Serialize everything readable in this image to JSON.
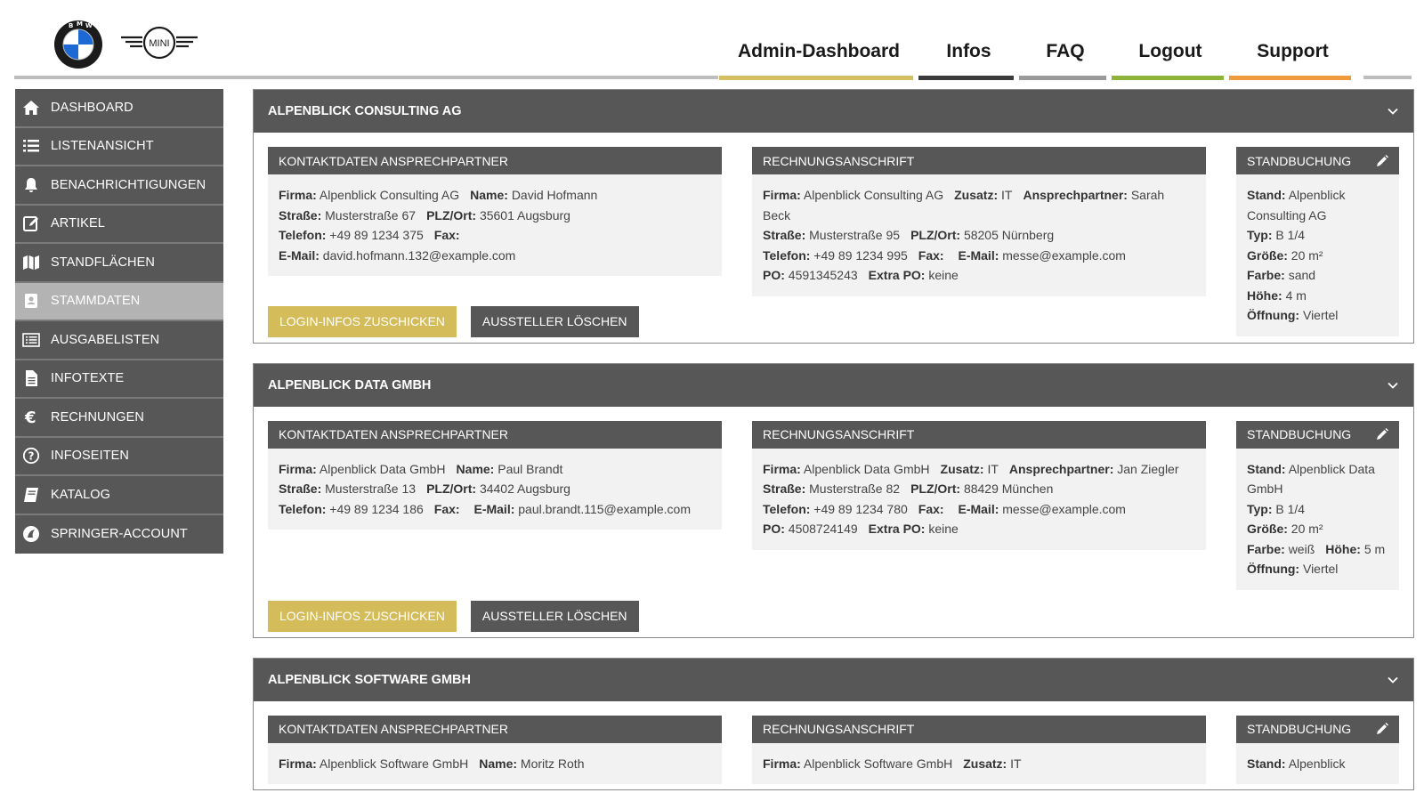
{
  "brand": {
    "logo_bmw_alt": "BMW",
    "logo_mini_alt": "MINI",
    "mini_text": "MINI"
  },
  "topnav": [
    {
      "label": "Admin-Dashboard",
      "color": "#d6bf60"
    },
    {
      "label": "Infos",
      "color": "#3a3a3a"
    },
    {
      "label": "FAQ",
      "color": "#9a9a9a"
    },
    {
      "label": "Logout",
      "color": "#8eb33a"
    },
    {
      "label": "Support",
      "color": "#ef9a3c"
    }
  ],
  "sidebar": [
    {
      "label": "DASHBOARD",
      "icon": "home-icon"
    },
    {
      "label": "LISTENANSICHT",
      "icon": "list-icon"
    },
    {
      "label": "BENACHRICHTIGUNGEN",
      "icon": "bell-icon"
    },
    {
      "label": "ARTIKEL",
      "icon": "edit-icon"
    },
    {
      "label": "STANDFLÄCHEN",
      "icon": "map-icon"
    },
    {
      "label": "STAMMDATEN",
      "icon": "contact-card-icon",
      "active": true
    },
    {
      "label": "AUSGABELISTEN",
      "icon": "table-list-icon"
    },
    {
      "label": "INFOTEXTE",
      "icon": "document-icon"
    },
    {
      "label": "RECHNUNGEN",
      "icon": "euro-icon"
    },
    {
      "label": "INFOSEITEN",
      "icon": "help-circle-icon"
    },
    {
      "label": "KATALOG",
      "icon": "catalog-icon"
    },
    {
      "label": "SPRINGER-ACCOUNT",
      "icon": "springer-icon"
    }
  ],
  "labels": {
    "contact_heading": "KONTAKTDATEN ANSPRECHPARTNER",
    "invoice_heading": "RECHNUNGSANSCHRIFT",
    "booking_heading": "STANDBUCHUNG",
    "firma": "Firma:",
    "name": "Name:",
    "strasse": "Straße:",
    "plzort": "PLZ/Ort:",
    "telefon": "Telefon:",
    "fax": "Fax:",
    "email": "E-Mail:",
    "zusatz": "Zusatz:",
    "ansprechpartner": "Ansprechpartner:",
    "po": "PO:",
    "extra_po": "Extra PO:",
    "stand": "Stand:",
    "typ": "Typ:",
    "groesse": "Größe:",
    "farbe": "Farbe:",
    "hoehe": "Höhe:",
    "oeffnung": "Öffnung:",
    "btn_login": "LOGIN-INFOS ZUSCHICKEN",
    "btn_delete": "AUSSTELLER LÖSCHEN"
  },
  "companies": [
    {
      "title": "ALPENBLICK CONSULTING AG",
      "contact": {
        "firma": "Alpenblick Consulting AG",
        "name": "David Hofmann",
        "strasse": "Musterstraße 67",
        "plzort": "35601 Augsburg",
        "telefon": "+49 89 1234 375",
        "fax": "",
        "email": "david.hofmann.132@example.com"
      },
      "invoice": {
        "firma": "Alpenblick Consulting AG",
        "zusatz": "IT",
        "ansprechpartner": "Sarah Beck",
        "strasse": "Musterstraße 95",
        "plzort": "58205 Nürnberg",
        "telefon": "+49 89 1234 995",
        "fax": "",
        "email": "messe@example.com",
        "po": "4591345243",
        "extra_po": "keine"
      },
      "booking": {
        "stand": "Alpenblick Consulting AG",
        "typ": "B 1/4",
        "groesse": "20 m²",
        "farbe": "sand",
        "hoehe": "4 m",
        "oeffnung": "Viertel"
      }
    },
    {
      "title": "ALPENBLICK DATA GMBH",
      "contact": {
        "firma": "Alpenblick Data GmbH",
        "name": "Paul Brandt",
        "strasse": "Musterstraße 13",
        "plzort": "34402 Augsburg",
        "telefon": "+49 89 1234 186",
        "fax": "",
        "email": "paul.brandt.115@example.com"
      },
      "invoice": {
        "firma": "Alpenblick Data GmbH",
        "zusatz": "IT",
        "ansprechpartner": "Jan Ziegler",
        "strasse": "Musterstraße 82",
        "plzort": "88429 München",
        "telefon": "+49 89 1234 780",
        "fax": "",
        "email": "messe@example.com",
        "po": "4508724149",
        "extra_po": "keine"
      },
      "booking": {
        "stand": "Alpenblick Data GmbH",
        "typ": "B 1/4",
        "groesse": "20 m²",
        "farbe": "weiß",
        "hoehe": "5 m",
        "oeffnung": "Viertel"
      }
    },
    {
      "title": "ALPENBLICK SOFTWARE GMBH",
      "contact": {
        "firma": "Alpenblick Software GmbH",
        "name": "Moritz Roth"
      },
      "invoice": {
        "firma": "Alpenblick Software GmbH",
        "zusatz": "IT"
      },
      "booking": {
        "stand": "Alpenblick"
      }
    }
  ]
}
